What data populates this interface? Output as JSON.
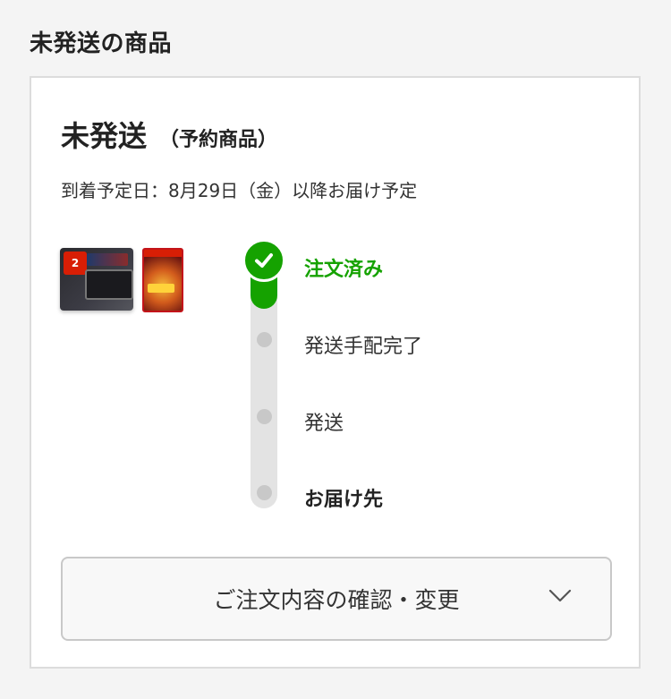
{
  "section": {
    "title": "未発送の商品"
  },
  "order": {
    "status": "未発送",
    "status_note": "（予約商品）",
    "delivery_text": "到着予定日：8月29日（金）以降お届け予定"
  },
  "products": [
    {
      "name": "switch-2-console-image"
    },
    {
      "name": "game-package-image"
    }
  ],
  "timeline": {
    "steps": [
      {
        "label": "注文済み",
        "state": "done"
      },
      {
        "label": "発送手配完了",
        "state": "pending"
      },
      {
        "label": "発送",
        "state": "pending"
      },
      {
        "label": "お届け先",
        "state": "pending"
      }
    ],
    "progress": 0.25,
    "colors": {
      "done": "#15a200",
      "pending": "#c8c8c8"
    }
  },
  "actions": {
    "confirm_label": "ご注文内容の確認・変更",
    "confirm_icon": "chevron-down-icon"
  },
  "switch_badge": "2"
}
